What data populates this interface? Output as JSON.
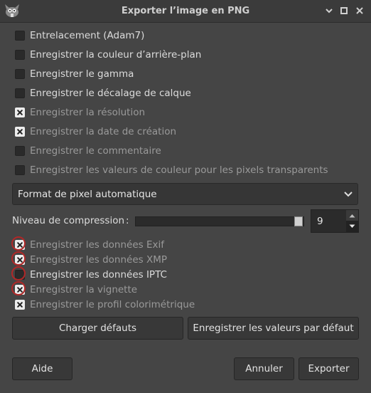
{
  "window": {
    "title": "Exporter l’image en PNG"
  },
  "options_top": [
    {
      "label": "Entrelacement (Adam7)",
      "checked": false,
      "dim": false
    },
    {
      "label": "Enregistrer la couleur d’arrière-plan",
      "checked": false,
      "dim": false
    },
    {
      "label": "Enregistrer le gamma",
      "checked": false,
      "dim": false
    },
    {
      "label": "Enregistrer le décalage de calque",
      "checked": false,
      "dim": false
    },
    {
      "label": "Enregistrer la résolution",
      "checked": true,
      "dim": true
    },
    {
      "label": "Enregistrer la date de création",
      "checked": true,
      "dim": true
    },
    {
      "label": "Enregistrer le commentaire",
      "checked": false,
      "dim": true
    },
    {
      "label": "Enregistrer les valeurs de couleur pour les pixels transparents",
      "checked": false,
      "dim": true
    }
  ],
  "pixel_format": {
    "value": "Format de pixel automatique"
  },
  "compression": {
    "label": "Niveau de compression",
    "colon": ":",
    "value": "9",
    "level": 9,
    "max": 9
  },
  "options_meta": [
    {
      "label": "Enregistrer les données Exif",
      "checked": true,
      "dim": true,
      "circled": true
    },
    {
      "label": "Enregistrer les données XMP",
      "checked": true,
      "dim": true,
      "circled": true
    },
    {
      "label": "Enregistrer les données IPTC",
      "checked": false,
      "dim": false,
      "circled": true
    },
    {
      "label": "Enregistrer la vignette",
      "checked": true,
      "dim": true,
      "circled": true
    },
    {
      "label": "Enregistrer le profil colorimétrique",
      "checked": true,
      "dim": true,
      "circled": false
    }
  ],
  "buttons": {
    "load_defaults": "Charger défauts",
    "save_defaults": "Enregistrer les valeurs par défaut",
    "help": "Aide",
    "cancel": "Annuler",
    "export": "Exporter"
  }
}
